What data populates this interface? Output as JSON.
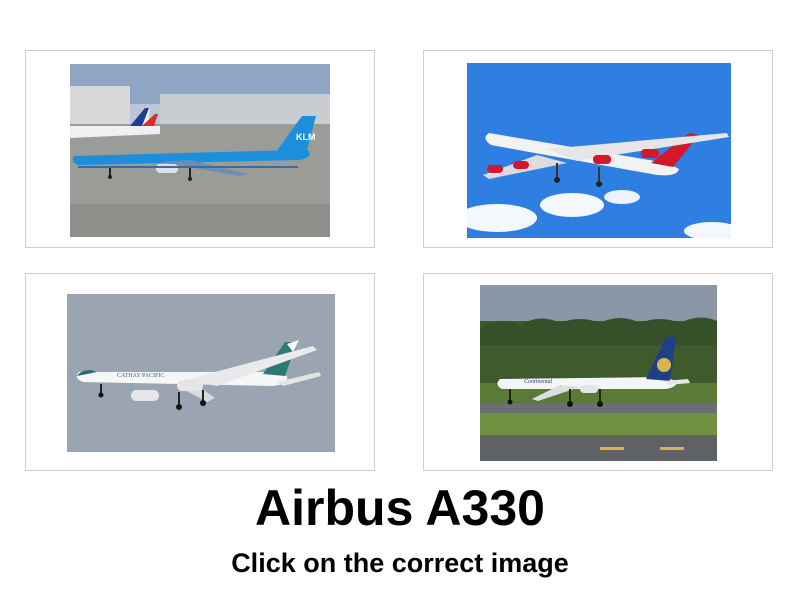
{
  "quiz": {
    "title": "Airbus A330",
    "instruction": "Click on the correct image"
  },
  "options": [
    {
      "icon": "klm-airliner-on-apron-photo",
      "tail_text": "KLM"
    },
    {
      "icon": "four-engine-airliner-in-flight-photo"
    },
    {
      "icon": "cathay-pacific-airliner-in-flight-photo",
      "fuselage_text": "CATHAY PACIFIC"
    },
    {
      "icon": "continental-airliner-on-runway-photo",
      "fuselage_text": "Continental"
    }
  ],
  "colors": {
    "klm_blue": "#1c8fdc",
    "sky_blue": "#2f7fe3",
    "virgin_red": "#d4172a",
    "hazy_sky": "#9aa5b1",
    "continental_navy": "#1f3f86",
    "card_border": "#cfcfcf"
  }
}
